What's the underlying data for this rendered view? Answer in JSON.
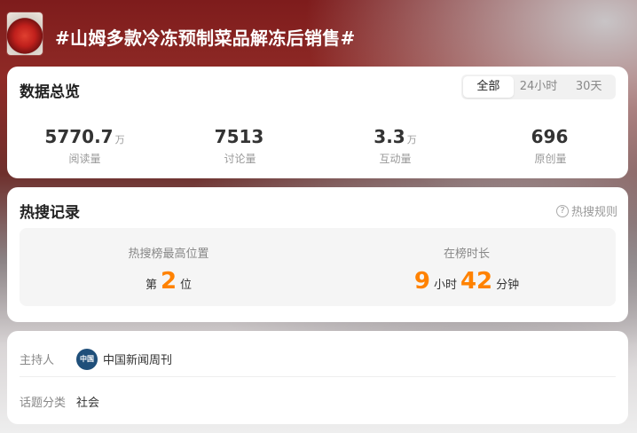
{
  "topic": {
    "title": "#山姆多款冷冻预制菜品解冻后销售#"
  },
  "overview": {
    "title": "数据总览",
    "tabs": [
      {
        "label": "全部",
        "active": true
      },
      {
        "label": "24小时",
        "active": false
      },
      {
        "label": "30天",
        "active": false
      }
    ],
    "stats": [
      {
        "value": "5770.7",
        "unit": "万",
        "label": "阅读量"
      },
      {
        "value": "7513",
        "unit": "",
        "label": "讨论量"
      },
      {
        "value": "3.3",
        "unit": "万",
        "label": "互动量"
      },
      {
        "value": "696",
        "unit": "",
        "label": "原创量"
      }
    ]
  },
  "hot": {
    "title": "热搜记录",
    "rules_label": "热搜规则",
    "peak": {
      "label": "热搜榜最高位置",
      "prefix": "第",
      "value": "2",
      "suffix": "位"
    },
    "duration": {
      "label": "在榜时长",
      "hours": "9",
      "hours_unit": "小时",
      "minutes": "42",
      "minutes_unit": "分钟"
    }
  },
  "info": {
    "host_label": "主持人",
    "host_name": "中国新闻周刊",
    "category_label": "话题分类",
    "category_value": "社会"
  },
  "colors": {
    "accent": "#ff8200",
    "header_bg": "#8f2a26"
  }
}
